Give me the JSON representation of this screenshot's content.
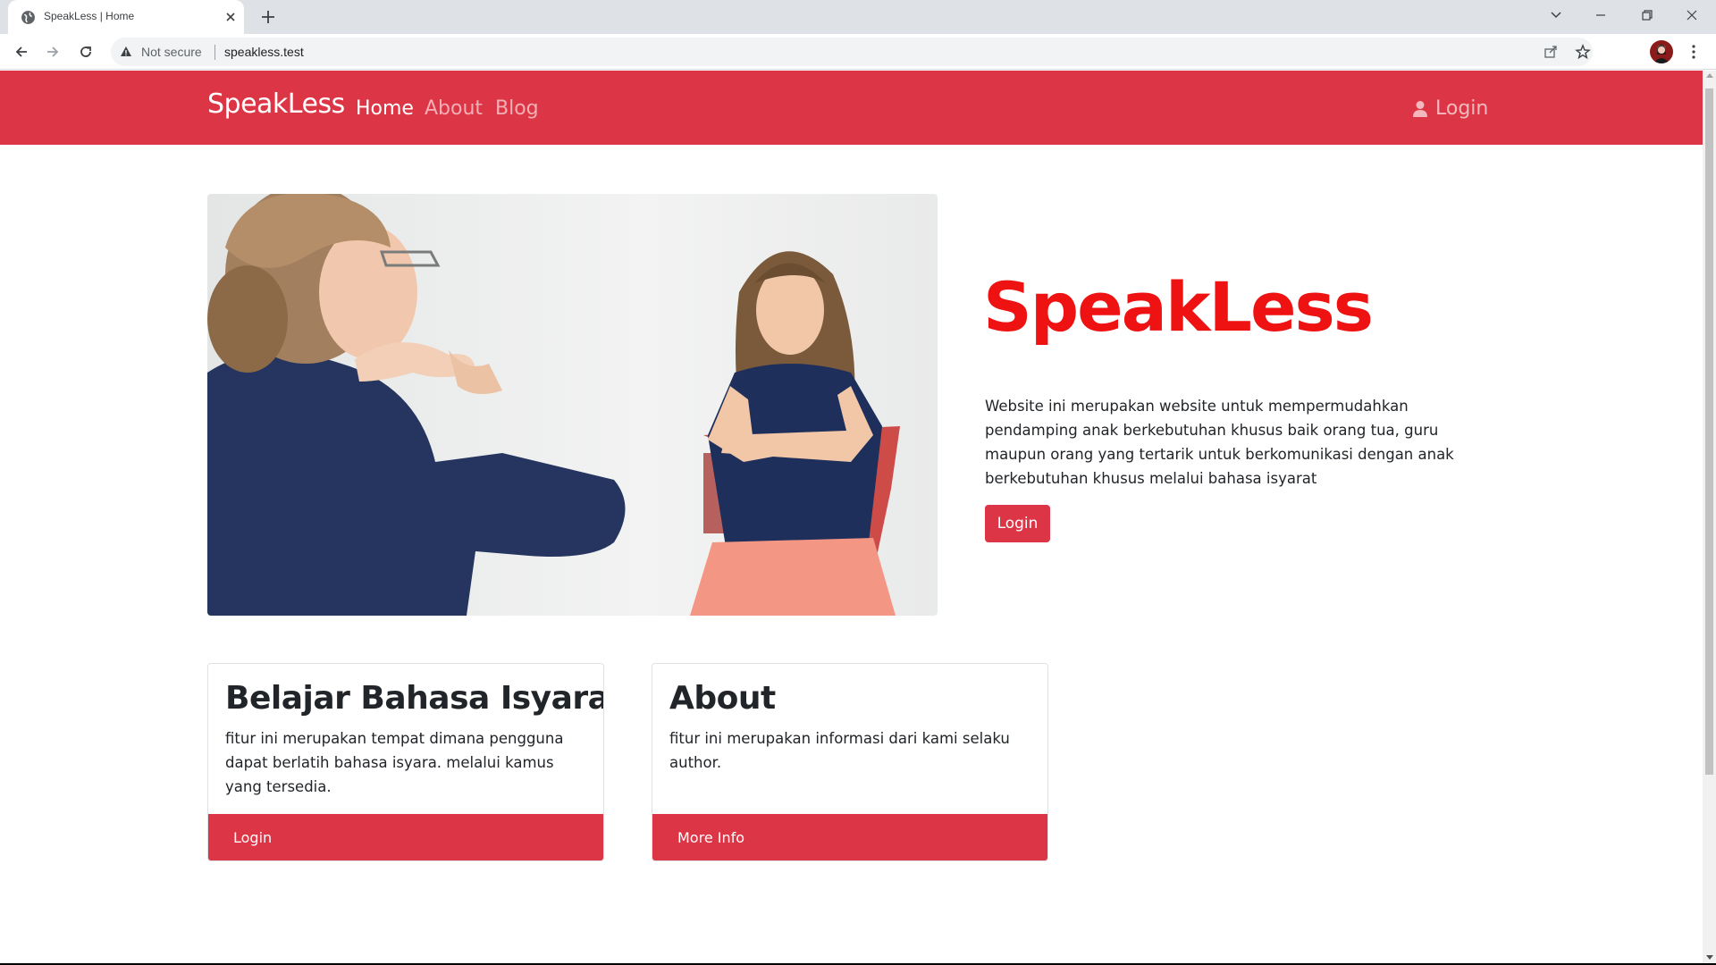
{
  "browser": {
    "tab_title": "SpeakLess | Home",
    "security_label": "Not secure",
    "url": "speakless.test"
  },
  "navbar": {
    "brand": "SpeakLess",
    "links": [
      {
        "label": "Home",
        "active": true
      },
      {
        "label": "About",
        "active": false
      },
      {
        "label": "Blog",
        "active": false
      }
    ],
    "login_label": "Login",
    "login_icon": "user-icon"
  },
  "hero": {
    "title": "SpeakLess",
    "description": "Website ini merupakan website untuk mempermudahkan pendamping anak berkebutuhan khusus baik orang tua, guru maupun orang yang tertarik untuk berkomunikasi dengan anak berkebutuhan khusus melalui bahasa isyarat",
    "button_label": "Login"
  },
  "cards": [
    {
      "title": "Belajar Bahasa Isyarat",
      "text": "fitur ini merupakan tempat dimana pengguna dapat berlatih bahasa isyara. melalui kamus yang tersedia.",
      "footer_label": "Login"
    },
    {
      "title": "About",
      "text": "fitur ini merupakan informasi dari kami selaku author.",
      "footer_label": "More Info"
    }
  ],
  "colors": {
    "brand_red": "#dc3545",
    "hero_title_red": "#ee1212"
  }
}
